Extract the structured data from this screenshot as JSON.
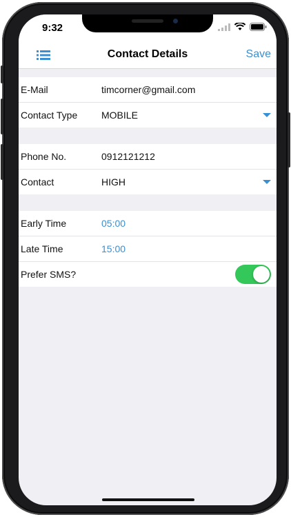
{
  "status_bar": {
    "time": "9:32"
  },
  "navbar": {
    "title": "Contact Details",
    "save_label": "Save",
    "menu_icon": "list-icon"
  },
  "groups": [
    {
      "rows": [
        {
          "label": "E-Mail",
          "value": "timcorner@gmail.com"
        },
        {
          "label": "Contact Type",
          "value": "MOBILE"
        }
      ]
    },
    {
      "rows": [
        {
          "label": "Phone No.",
          "value": "0912121212"
        },
        {
          "label": "Contact",
          "value": "HIGH"
        }
      ]
    },
    {
      "rows": [
        {
          "label": "Early Time",
          "value": "05:00"
        },
        {
          "label": "Late Time",
          "value": "15:00"
        },
        {
          "label": "Prefer SMS?",
          "toggle_on": true
        }
      ]
    }
  ],
  "colors": {
    "accent": "#3a8fd0",
    "toggle_on": "#34c759",
    "background": "#efeff4"
  }
}
